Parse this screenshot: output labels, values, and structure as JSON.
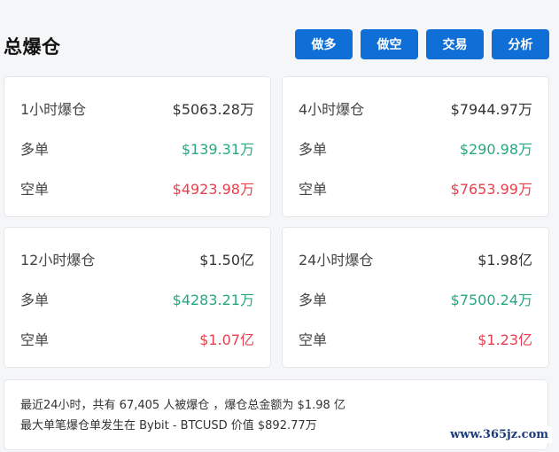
{
  "header": {
    "title": "总爆仓",
    "buttons": [
      "做多",
      "做空",
      "交易",
      "分析"
    ]
  },
  "cards": [
    {
      "label": "1小时爆仓",
      "total": "$5063.28万",
      "long_label": "多单",
      "long": "$139.31万",
      "short_label": "空单",
      "short": "$4923.98万"
    },
    {
      "label": "4小时爆仓",
      "total": "$7944.97万",
      "long_label": "多单",
      "long": "$290.98万",
      "short_label": "空单",
      "short": "$7653.99万"
    },
    {
      "label": "12小时爆仓",
      "total": "$1.50亿",
      "long_label": "多单",
      "long": "$4283.21万",
      "short_label": "空单",
      "short": "$1.07亿"
    },
    {
      "label": "24小时爆仓",
      "total": "$1.98亿",
      "long_label": "多单",
      "long": "$7500.24万",
      "short_label": "空单",
      "short": "$1.23亿"
    }
  ],
  "summary": {
    "line1": "最近24小时，共有 67,405 人被爆仓 ，爆仓总金额为 $1.98 亿",
    "line2": "最大单笔爆仓单发生在 Bybit - BTCUSD 价值 $892.77万"
  },
  "watermark": "www.365jz.com",
  "colors": {
    "button": "#0f6fd6",
    "long": "#27a882",
    "short": "#e8404f"
  }
}
